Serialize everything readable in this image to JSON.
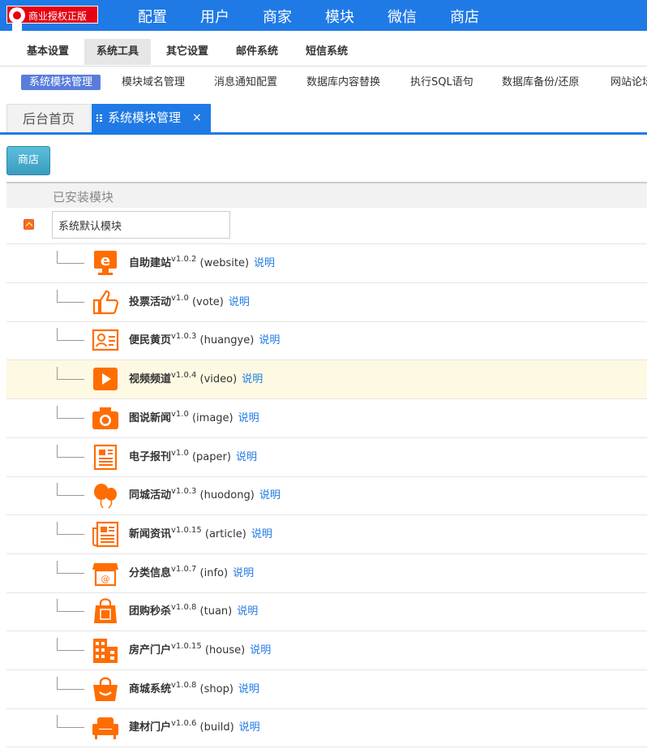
{
  "badge": {
    "label": "商业授权正版"
  },
  "topnav": [
    "配置",
    "用户",
    "商家",
    "模块",
    "微信",
    "商店"
  ],
  "subnav": [
    "基本设置",
    "系统工具",
    "其它设置",
    "邮件系统",
    "短信系统"
  ],
  "subnav_active_index": 1,
  "toolnav": [
    "系统模块管理",
    "模块域名管理",
    "消息通知配置",
    "数据库内容替换",
    "执行SQL语句",
    "数据库备份/还原",
    "网站论坛"
  ],
  "tabs": {
    "home": "后台首页",
    "current": "系统模块管理",
    "close": "×"
  },
  "shop_button": "商店",
  "installed": {
    "heading": "已安装模块",
    "group_value": "系统默认模块"
  },
  "modules": [
    {
      "name": "自助建站",
      "version": "v1.0.2",
      "key": "(website)",
      "link": "说明",
      "icon": "ie-icon"
    },
    {
      "name": "投票活动",
      "version": "v1.0",
      "key": "(vote)",
      "link": "说明",
      "icon": "thumbs-up-icon"
    },
    {
      "name": "便民黄页",
      "version": "v1.0.3",
      "key": "(huangye)",
      "link": "说明",
      "icon": "contact-card-icon"
    },
    {
      "name": "视频频道",
      "version": "v1.0.4",
      "key": "(video)",
      "link": "说明",
      "icon": "play-icon"
    },
    {
      "name": "图说新闻",
      "version": "v1.0",
      "key": "(image)",
      "link": "说明",
      "icon": "camera-icon"
    },
    {
      "name": "电子报刊",
      "version": "v1.0",
      "key": "(paper)",
      "link": "说明",
      "icon": "document-icon"
    },
    {
      "name": "同城活动",
      "version": "v1.0.3",
      "key": "(huodong)",
      "link": "说明",
      "icon": "balloon-icon"
    },
    {
      "name": "新闻资讯",
      "version": "v1.0.15",
      "key": "(article)",
      "link": "说明",
      "icon": "newspaper-icon"
    },
    {
      "name": "分类信息",
      "version": "v1.0.7",
      "key": "(info)",
      "link": "说明",
      "icon": "storefront-icon"
    },
    {
      "name": "团购秒杀",
      "version": "v1.0.8",
      "key": "(tuan)",
      "link": "说明",
      "icon": "shopping-bag-icon"
    },
    {
      "name": "房产门户",
      "version": "v1.0.15",
      "key": "(house)",
      "link": "说明",
      "icon": "building-icon"
    },
    {
      "name": "商城系统",
      "version": "v1.0.8",
      "key": "(shop)",
      "link": "说明",
      "icon": "basket-icon"
    },
    {
      "name": "建材门户",
      "version": "v1.0.6",
      "key": "(build)",
      "link": "说明",
      "icon": "sofa-icon"
    }
  ],
  "highlight_row_index": 3,
  "colors": {
    "topbar": "#1f7ae6",
    "icon": "#ff6d00",
    "link": "#1f7ae6",
    "highlight": "#fdf9e3"
  }
}
